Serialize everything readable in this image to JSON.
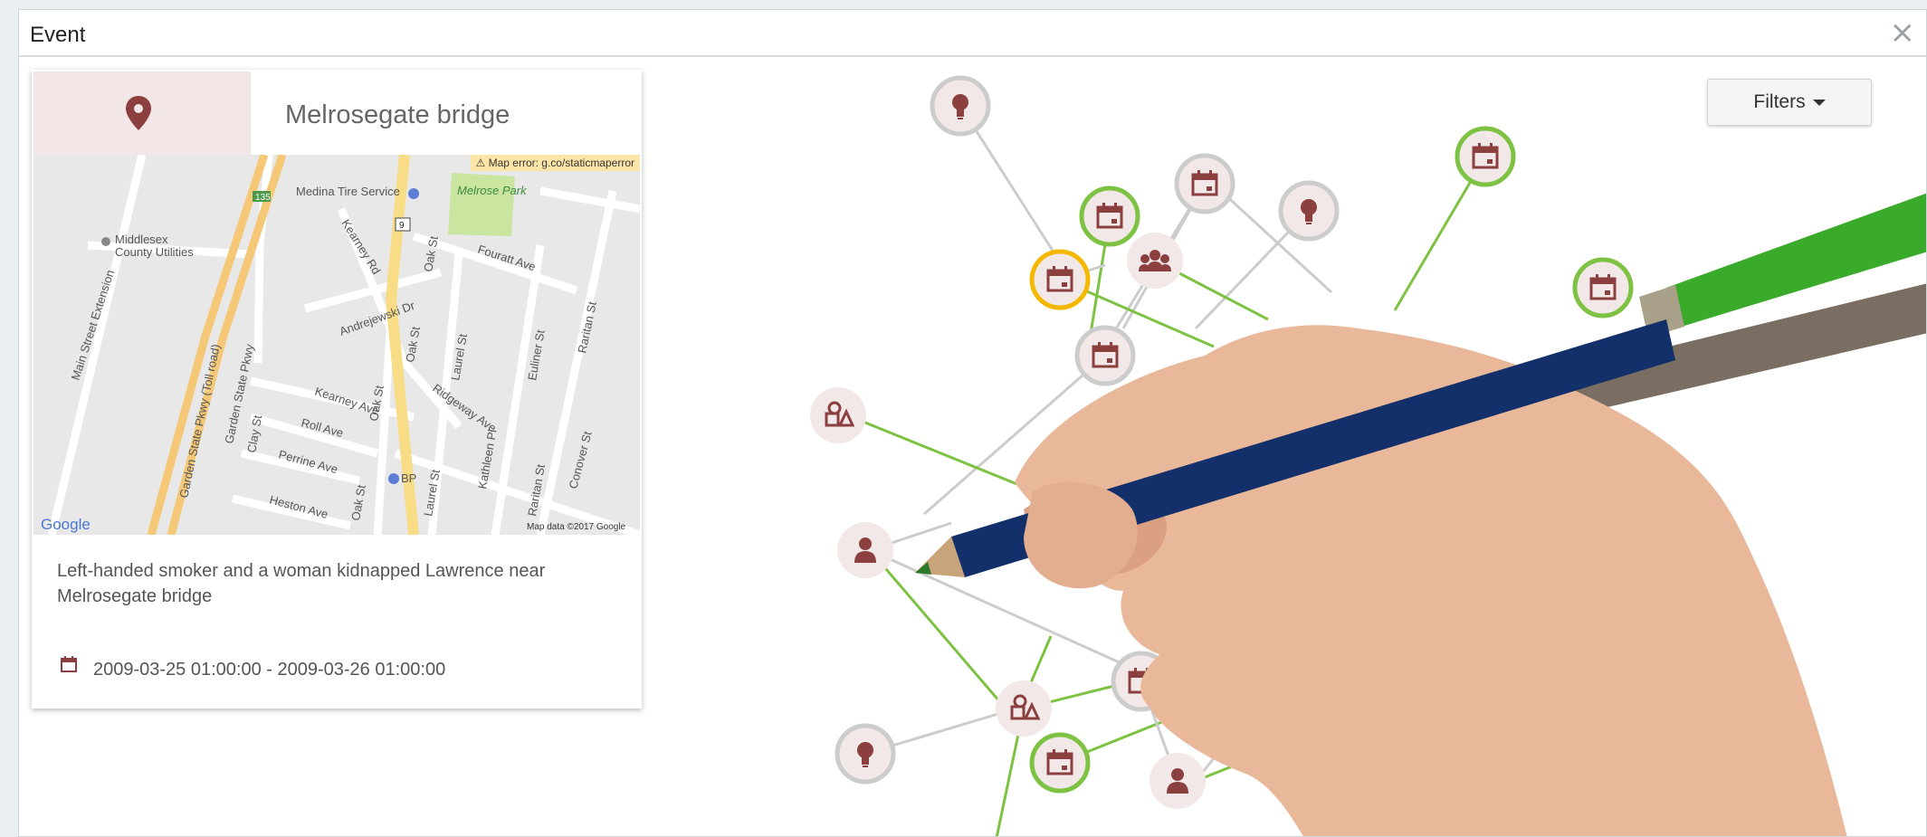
{
  "dialog": {
    "title": "Event",
    "close_symbol": "×"
  },
  "card": {
    "location_title": "Melrosegate bridge",
    "map": {
      "error_text": "⚠ Map error: g.co/staticmaperror",
      "attribution_logo": "Google",
      "attribution_data": "Map data ©2017 Google",
      "places": [
        "Medina Tire Service",
        "Melrose Park",
        "Middlesex",
        "County Utilities",
        "BP"
      ],
      "streets": [
        "Main Street Extension",
        "Garden State Pkwy (Toll road)",
        "Garden State Pkwy",
        "Kearney Rd",
        "Oak St",
        "Fouratt Ave",
        "Andrejewski Dr",
        "Kearney Ave",
        "Roll Ave",
        "Perrine Ave",
        "Clay St",
        "Heston Ave",
        "Laurel St",
        "Ridgeway Ave",
        "Euliner St",
        "Raritan St",
        "Kathleen Pl",
        "Conover St"
      ],
      "route_shields": [
        "135",
        "9"
      ]
    },
    "description": "Left-handed smoker and a woman kidnapped Lawrence near Melrosegate bridge",
    "date_range": "2009-03-25 01:00:00 - 2009-03-26 01:00:00"
  },
  "filters": {
    "label": "Filters"
  },
  "colors": {
    "accent": "#8b3f3f",
    "green": "#7dc242",
    "gray": "#cccccc",
    "orange": "#f5b800",
    "node_fill": "#f3e8e8"
  },
  "graph": {
    "nodes": [
      {
        "id": "n1",
        "icon": "lightbulb-icon",
        "ring": "gray"
      },
      {
        "id": "n2",
        "icon": "calendar-icon",
        "ring": "gray"
      },
      {
        "id": "n3",
        "icon": "calendar-icon",
        "ring": "green"
      },
      {
        "id": "n4",
        "icon": "calendar-icon",
        "ring": "orange"
      },
      {
        "id": "n5",
        "icon": "group-icon",
        "ring": "none"
      },
      {
        "id": "n6",
        "icon": "lightbulb-icon",
        "ring": "gray"
      },
      {
        "id": "n7",
        "icon": "calendar-icon",
        "ring": "green"
      },
      {
        "id": "n8",
        "icon": "calendar-icon",
        "ring": "green"
      },
      {
        "id": "n9",
        "icon": "calendar-icon",
        "ring": "gray"
      },
      {
        "id": "n10",
        "icon": "objects-icon",
        "ring": "none"
      },
      {
        "id": "n11",
        "icon": "person-icon",
        "ring": "none"
      },
      {
        "id": "n12",
        "icon": "objects-icon",
        "ring": "none"
      },
      {
        "id": "n13",
        "icon": "calendar-icon",
        "ring": "gray"
      },
      {
        "id": "n14",
        "icon": "lightbulb-icon",
        "ring": "gray"
      },
      {
        "id": "n15",
        "icon": "calendar-icon",
        "ring": "green"
      },
      {
        "id": "n16",
        "icon": "person-icon",
        "ring": "none"
      }
    ],
    "overlay": "hand-drawing-pencil"
  }
}
